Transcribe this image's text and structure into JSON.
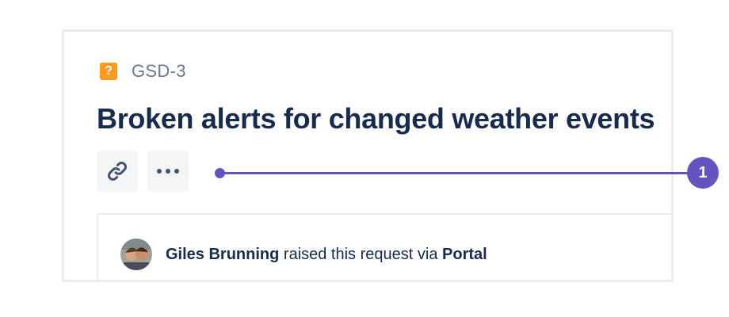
{
  "issue": {
    "type_icon": "question-icon",
    "type_glyph": "?",
    "type_color": "#ff991f",
    "key": "GSD-3",
    "title": "Broken alerts for changed weather events"
  },
  "actions": [
    {
      "icon": "link-icon"
    },
    {
      "icon": "more-icon"
    }
  ],
  "activity": {
    "author": "Giles Brunning",
    "middle_text": "raised this request via",
    "channel": "Portal"
  },
  "callout": {
    "number": "1",
    "color": "#6554c0"
  },
  "colors": {
    "title": "#172b4d",
    "key": "#6b778c",
    "button_bg": "#f4f5f7",
    "border": "#ebecf0"
  }
}
